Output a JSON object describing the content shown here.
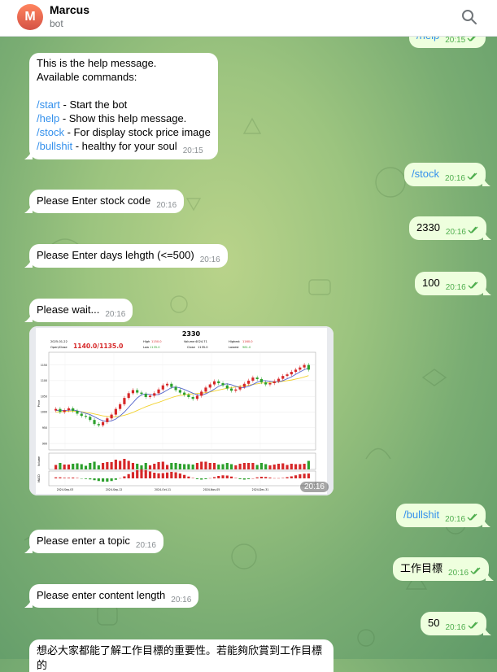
{
  "header": {
    "avatar_letter": "M",
    "name": "Marcus",
    "status": "bot",
    "search_icon": "search-icon"
  },
  "messages": {
    "m0": {
      "text": "/help",
      "time": "20:15"
    },
    "m1": {
      "line1": "This is the help message.",
      "line2": "Available commands:",
      "cmd_start": "/start",
      "desc_start": " - Start the bot",
      "cmd_help": "/help",
      "desc_help": " - Show this help message.",
      "cmd_stock": "/stock",
      "desc_stock": " - For display stock price image",
      "cmd_bullshit": "/bullshit",
      "desc_bullshit": " - healthy for your soul",
      "time": "20:15"
    },
    "m2": {
      "text": "/stock",
      "time": "20:16"
    },
    "m3": {
      "text": "Please Enter stock code",
      "time": "20:16"
    },
    "m4": {
      "text": "2330",
      "time": "20:16"
    },
    "m5": {
      "text": "Please Enter days lehgth (<=500)",
      "time": "20:16"
    },
    "m6": {
      "text": "100",
      "time": "20:16"
    },
    "m7": {
      "text": "Please wait...",
      "time": "20:16"
    },
    "m8": {
      "time": "20:16",
      "chart": {
        "title": "2330",
        "date": "2025-01-22",
        "openclose_label": "Open/Close",
        "openclose_value": "1140.0/1135.0",
        "high_label": "High",
        "high_value": "1150.0",
        "volume_label": "Volume",
        "volume_value": "4024.71",
        "highest_label": "Highest",
        "highest_value": "1160.0",
        "low_label": "Low",
        "low_value": "1135.0",
        "close_label": "Close",
        "close_value": "1135.0",
        "lowest_label": "Lowest",
        "lowest_value": "981.0",
        "ylabel": "Price",
        "yticks": [
          "1150",
          "1100",
          "1050",
          "1000",
          "950",
          "900"
        ],
        "xticks": [
          "2024-Sep-03",
          "2024-Sep-12",
          "2024-Oct-11",
          "2024-Nov-05",
          "2024-Dec-31"
        ],
        "sublabel1": "Volume",
        "sublabel2": "MACD"
      }
    },
    "m9": {
      "text": "/bullshit",
      "time": "20:16"
    },
    "m10": {
      "text": "Please enter a topic",
      "time": "20:16"
    },
    "m11": {
      "text": "工作目標",
      "time": "20:16"
    },
    "m12": {
      "text": "Please enter content length",
      "time": "20:16"
    },
    "m13": {
      "text": "50",
      "time": "20:16"
    },
    "m14": {
      "text": "想必大家都能了解工作目標的重要性。若能夠欣賞到工作目標的"
    }
  },
  "colors": {
    "incoming_bg": "#ffffff",
    "outgoing_bg": "#eeffde",
    "link": "#3390ec",
    "read_tick": "#4fae4e",
    "candle_up": "#d62728",
    "candle_down": "#2ca02c"
  },
  "chart_data": {
    "type": "candlestick",
    "title": "2330",
    "ylabel": "Price",
    "ylim": [
      890,
      1180
    ],
    "open": [
      1005,
      1010,
      1000,
      1006,
      1012,
      1004,
      995,
      988,
      985,
      975,
      962,
      958,
      968,
      980,
      992,
      1010,
      1025,
      1045,
      1060,
      1070,
      1062,
      1058,
      1048,
      1052,
      1060,
      1072,
      1085,
      1090,
      1080,
      1070,
      1062,
      1055,
      1048,
      1042,
      1052,
      1065,
      1078,
      1088,
      1098,
      1092,
      1085,
      1075,
      1068,
      1072,
      1080,
      1090,
      1100,
      1110,
      1105,
      1095,
      1088,
      1092,
      1098,
      1106,
      1115,
      1120,
      1128,
      1135,
      1142,
      1150
    ],
    "close": [
      1010,
      1000,
      1006,
      1012,
      1004,
      995,
      988,
      985,
      975,
      962,
      958,
      968,
      980,
      992,
      1010,
      1025,
      1045,
      1060,
      1070,
      1062,
      1058,
      1048,
      1052,
      1060,
      1072,
      1085,
      1090,
      1080,
      1070,
      1062,
      1055,
      1048,
      1042,
      1052,
      1065,
      1078,
      1088,
      1098,
      1092,
      1085,
      1075,
      1068,
      1072,
      1080,
      1090,
      1100,
      1110,
      1105,
      1095,
      1088,
      1092,
      1098,
      1106,
      1115,
      1120,
      1128,
      1135,
      1142,
      1150,
      1135
    ],
    "ma_short": [
      1005,
      1006,
      1005,
      1006,
      1007,
      1004,
      1000,
      996,
      992,
      985,
      978,
      972,
      970,
      972,
      978,
      988,
      1000,
      1015,
      1030,
      1045,
      1055,
      1058,
      1056,
      1055,
      1056,
      1062,
      1070,
      1078,
      1080,
      1077,
      1072,
      1066,
      1060,
      1055,
      1054,
      1058,
      1065,
      1073,
      1082,
      1088,
      1090,
      1087,
      1082,
      1078,
      1078,
      1082,
      1088,
      1095,
      1100,
      1100,
      1098,
      1096,
      1097,
      1100,
      1106,
      1112,
      1120,
      1128,
      1135,
      1140
    ],
    "ma_long": [
      1000,
      1001,
      1002,
      1003,
      1003,
      1002,
      1001,
      999,
      997,
      994,
      991,
      988,
      986,
      985,
      985,
      987,
      990,
      994,
      999,
      1005,
      1011,
      1017,
      1022,
      1027,
      1031,
      1036,
      1041,
      1046,
      1050,
      1053,
      1055,
      1057,
      1058,
      1059,
      1060,
      1062,
      1064,
      1067,
      1070,
      1073,
      1076,
      1078,
      1080,
      1082,
      1084,
      1086,
      1088,
      1090,
      1092,
      1093,
      1094,
      1095,
      1096,
      1098,
      1100,
      1102,
      1105,
      1108,
      1112,
      1116
    ]
  }
}
